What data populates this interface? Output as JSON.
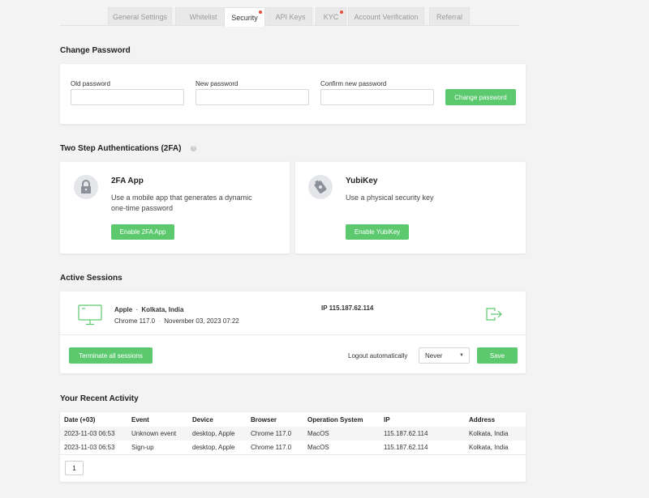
{
  "tabs": [
    {
      "label": "General Settings",
      "dot": false,
      "active": false
    },
    {
      "label": "Whitelist",
      "dot": true,
      "active": false
    },
    {
      "label": "Security",
      "dot": true,
      "active": true
    },
    {
      "label": "API Keys",
      "dot": false,
      "active": false
    },
    {
      "label": "KYC",
      "dot": true,
      "active": false
    },
    {
      "label": "Account Verification",
      "dot": false,
      "active": false
    },
    {
      "label": "Referral",
      "dot": false,
      "active": false
    }
  ],
  "change_password": {
    "title": "Change Password",
    "old_label": "Old password",
    "new_label": "New password",
    "confirm_label": "Confirm new password",
    "old_value": "",
    "new_value": "",
    "confirm_value": "",
    "button": "Change password"
  },
  "twofa": {
    "title": "Two Step Authentications (2FA)",
    "help": "?",
    "app": {
      "title": "2FA App",
      "desc_line1": "Use a mobile app that generates a dynamic",
      "desc_line2": "one-time password",
      "button": "Enable 2FA App",
      "icon": "padlock-icon"
    },
    "yubikey": {
      "title": "YubiKey",
      "desc": "Use a physical security key",
      "button": "Enable YubiKey",
      "icon": "security-key-icon"
    }
  },
  "sessions": {
    "title": "Active Sessions",
    "device": "Apple",
    "separator": "·",
    "location": "Kolkata, India",
    "browser": "Chrome 117.0",
    "date": "November 03, 2023 07:22",
    "ip": "IP 115.187.62.114",
    "terminate_button": "Terminate all sessions",
    "logout_label": "Logout automatically",
    "logout_value": "Never",
    "save_button": "Save"
  },
  "activity": {
    "title": "Your Recent Activity",
    "columns": [
      "Date (+03)",
      "Event",
      "Device",
      "Browser",
      "Operation System",
      "IP",
      "Address"
    ],
    "rows": [
      [
        "2023-11-03 06:53",
        "Unknown event",
        "desktop, Apple",
        "Chrome 117.0",
        "MacOS",
        "115.187.62.114",
        "Kolkata, India"
      ],
      [
        "2023-11-03 06:53",
        "Sign-up",
        "desktop, Apple",
        "Chrome 117.0",
        "MacOS",
        "115.187.62.114",
        "Kolkata, India"
      ]
    ],
    "page": "1"
  },
  "colors": {
    "accent": "#5cc96f",
    "notification_dot": "#e74c3c",
    "background": "#f3f3f3"
  }
}
